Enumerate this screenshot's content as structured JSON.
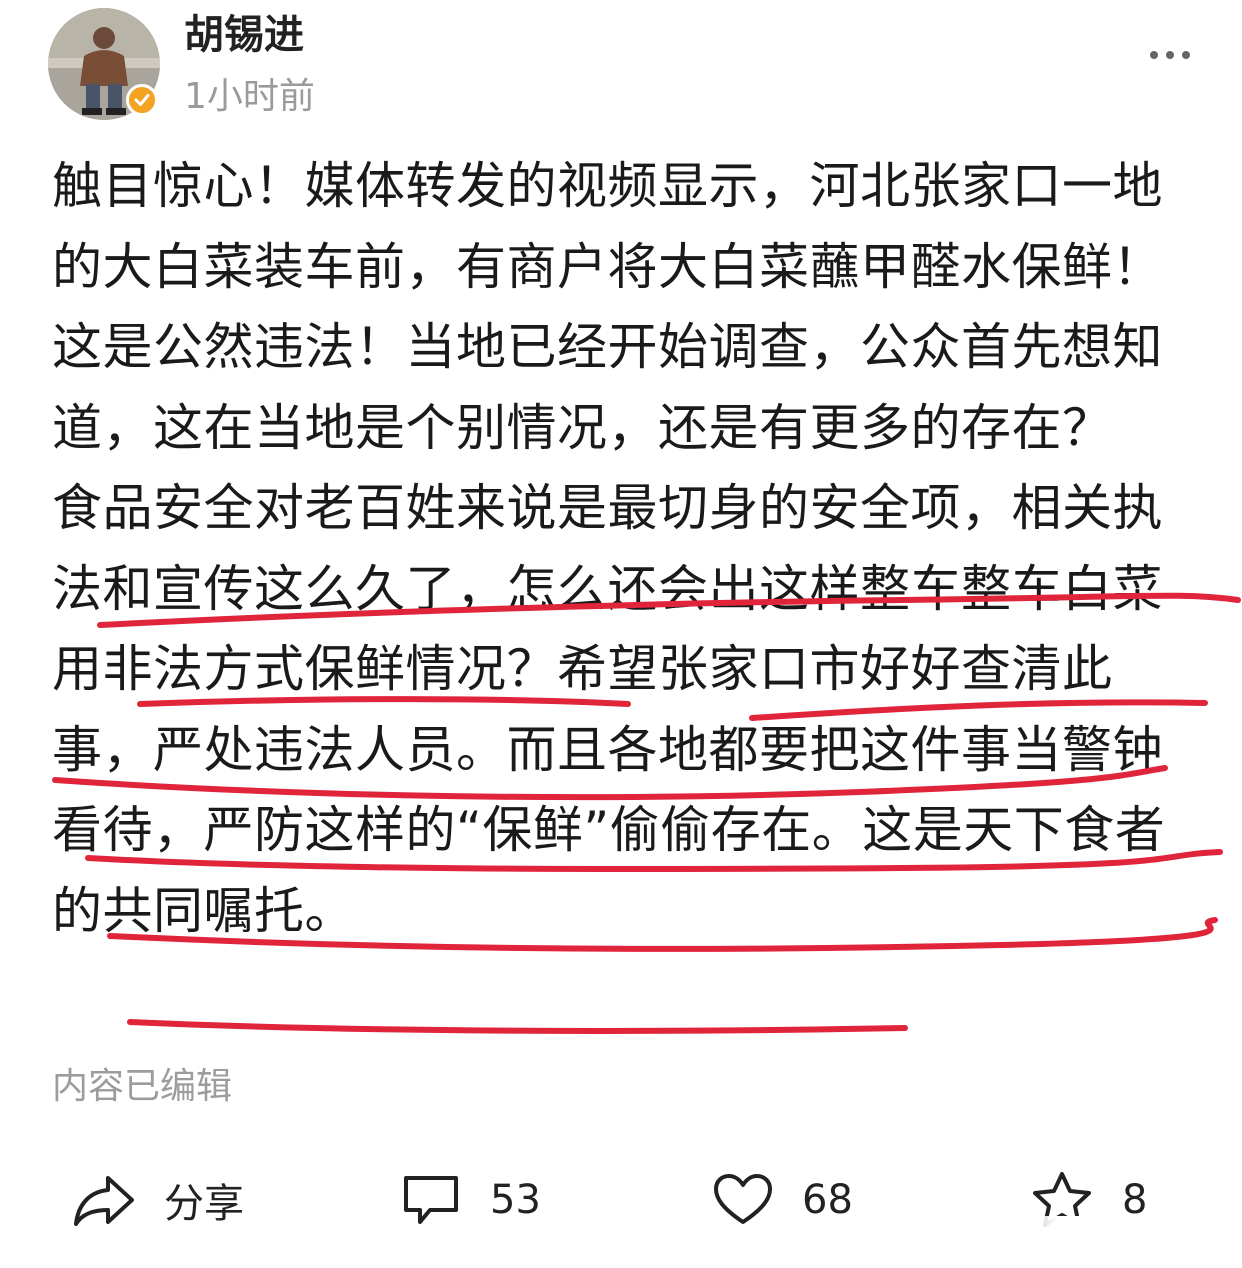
{
  "author": {
    "name": "胡锡进",
    "time": "1小时前"
  },
  "post": {
    "paragraph1": "触目惊心！媒体转发的视频显示，河北张家口一地的大白菜装车前，有商户将大白菜蘸甲醛水保鲜！这是公然违法！当地已经开始调查，公众首先想知道，这在当地是个别情况，还是有更多的存在？",
    "paragraph2": "食品安全对老百姓来说是最切身的安全项，相关执法和宣传这么久了，怎么还会出这样整车整车白菜用非法方式保鲜情况？希望张家口市好好查清此事，严处违法人员。而且各地都要把这件事当警钟看待，严防这样的“保鲜”偷偷存在。这是天下食者的共同嘱托。",
    "edited_note": "内容已编辑"
  },
  "actions": {
    "share_label": "分享",
    "comment_count": "53",
    "like_count": "68",
    "favorite_count": "8"
  },
  "colors": {
    "annotation_red": "#e0243a",
    "muted_text": "#9a9a9a",
    "badge": "#f3a321"
  },
  "icons": [
    "more-icon",
    "share-icon",
    "comment-icon",
    "heart-icon",
    "star-icon",
    "verified-badge-icon"
  ]
}
